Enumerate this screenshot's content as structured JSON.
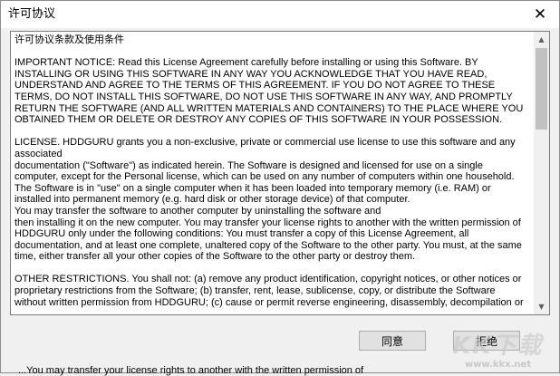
{
  "window": {
    "title": "许可协议",
    "close_symbol": "✕"
  },
  "license": {
    "heading": "许可协议条款及使用条件",
    "paragraphs": [
      "IMPORTANT NOTICE: Read this License Agreement carefully before installing or using this Software. BY INSTALLING OR USING THIS SOFTWARE IN ANY WAY YOU ACKNOWLEDGE THAT YOU HAVE READ, UNDERSTAND AND AGREE TO THE TERMS OF THIS AGREEMENT. IF YOU DO NOT AGREE TO THESE TERMS, DO NOT INSTALL THIS SOFTWARE, DO NOT USE THIS SOFTWARE IN ANY WAY, AND PROMPTLY RETURN THE SOFTWARE (AND ALL WRITTEN MATERIALS AND CONTAINERS) TO THE PLACE WHERE YOU OBTAINED THEM OR DELETE OR DESTROY ANY COPIES OF THIS SOFTWARE IN YOUR POSSESSION.",
      "LICENSE. HDDGURU grants you a non-exclusive, private or commercial use license to use this software and any associated\ndocumentation (\"Software\") as indicated herein.  The Software is designed and licensed for use on a single computer, except for the Personal license, which can be used on any number of computers within one household.\nThe Software is in \"use\" on a single computer when it has been loaded into temporary memory (i.e. RAM) or installed into permanent memory (e.g. hard disk or other storage device) of that computer.\nYou may transfer the software to another computer by uninstalling the software and\nthen installing it on the new computer. You may transfer your license rights to another with the written permission of HDDGURU only under the following conditions: You must transfer a copy of this License Agreement, all documentation, and at least one complete, unaltered copy of the Software to the other party.  You must, at the same time, either transfer all your other copies of the Software to the other party or destroy them.",
      "OTHER RESTRICTIONS. You shall not: (a) remove any product identification, copyright notices, or other notices or proprietary restrictions from the Software; (b) transfer, rent, lease, sublicense, copy, or distribute the Software without written permission from HDDGURU; (c) cause or permit reverse engineering, disassembly, decompilation or"
    ]
  },
  "buttons": {
    "agree": "同意",
    "decline": "拒绝"
  },
  "watermark": {
    "logo": "KK下载",
    "url": "www.kkx.net"
  },
  "background_text": "...You may transfer your license rights to another with the written permission of"
}
